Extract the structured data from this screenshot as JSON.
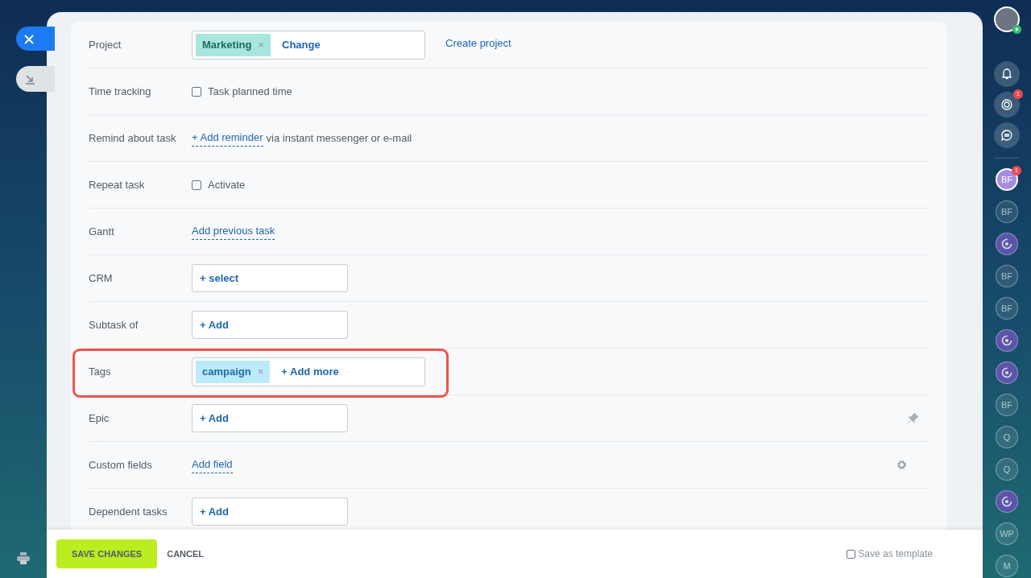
{
  "rows": [
    {
      "label": "Project",
      "kind": "tag_picker",
      "tags": [
        {
          "label": "Marketing",
          "color": "#a8e6de",
          "remove": "×"
        }
      ],
      "action": "Change",
      "side_link": "Create project",
      "highlighted": false
    },
    {
      "label": "Time tracking",
      "kind": "checkbox",
      "text": "Task planned time",
      "checked": false
    },
    {
      "label": "Remind about task",
      "kind": "reminder",
      "link": "+ Add reminder",
      "text": "via instant messenger or e-mail"
    },
    {
      "label": "Repeat task",
      "kind": "checkbox",
      "text": "Activate",
      "checked": false
    },
    {
      "label": "Gantt",
      "kind": "link",
      "link": "Add previous task"
    },
    {
      "label": "CRM",
      "kind": "add_box",
      "action": "+ select"
    },
    {
      "label": "Subtask of",
      "kind": "add_box",
      "action": "+ Add"
    },
    {
      "label": "Tags",
      "kind": "tag_picker",
      "tags": [
        {
          "label": "campaign",
          "color": "#bdeaf9",
          "remove": "×"
        }
      ],
      "action": "+ Add more",
      "highlighted": true
    },
    {
      "label": "Epic",
      "kind": "add_box",
      "action": "+ Add",
      "side_icon": {
        "kind": "pin"
      }
    },
    {
      "label": "Custom fields",
      "kind": "link",
      "link": "Add field",
      "side_icon": {
        "kind": "gear"
      }
    },
    {
      "label": "Dependent tasks",
      "kind": "add_box",
      "action": "+ Add"
    }
  ],
  "footer": {
    "save": "SAVE CHANGES",
    "cancel": "CANCEL",
    "template": {
      "label": "Save as template",
      "checked": false
    }
  },
  "right_bar": {
    "tools": [
      {
        "kind": "bell"
      },
      {
        "kind": "target",
        "badge": "1"
      },
      {
        "kind": "chat"
      }
    ],
    "chats": [
      {
        "kind": "initials",
        "label": "BF",
        "badge": "1",
        "selected": true
      },
      {
        "kind": "initials",
        "label": "BF",
        "selected": false
      },
      {
        "kind": "logo",
        "selected": false
      },
      {
        "kind": "initials",
        "label": "BF",
        "selected": false
      },
      {
        "kind": "initials",
        "label": "BF",
        "selected": false
      },
      {
        "kind": "logo",
        "selected": false
      },
      {
        "kind": "logo",
        "selected": false
      },
      {
        "kind": "initials",
        "label": "BF",
        "selected": false
      },
      {
        "kind": "initials",
        "label": "Q",
        "selected": false
      },
      {
        "kind": "initials",
        "label": "Q",
        "selected": false
      },
      {
        "kind": "logo",
        "selected": false
      },
      {
        "kind": "initials",
        "label": "WP",
        "selected": false
      },
      {
        "kind": "initials",
        "label": "M",
        "selected": false
      }
    ]
  }
}
